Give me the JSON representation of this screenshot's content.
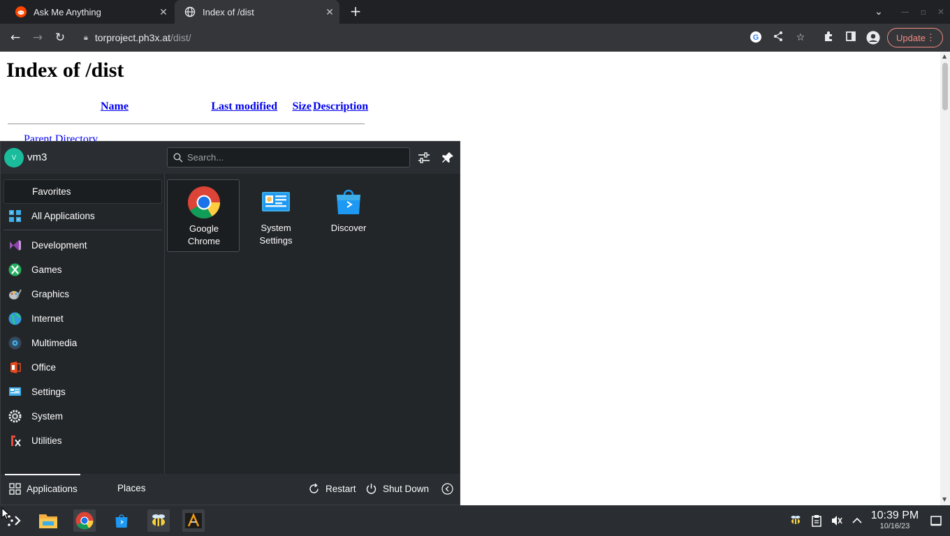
{
  "browser": {
    "tabs": [
      {
        "title": "Ask Me Anything",
        "active": false
      },
      {
        "title": "Index of /dist",
        "active": true
      }
    ],
    "url_host": "torproject.ph3x.at",
    "url_path": "/dist/",
    "update_label": "Update"
  },
  "page": {
    "heading": "Index of /dist",
    "columns": [
      "Name",
      "Last modified",
      "Size",
      "Description"
    ],
    "parent_link": "Parent Directory"
  },
  "launcher": {
    "user": "vm3",
    "avatar_letter": "V",
    "search_placeholder": "Search...",
    "categories": [
      {
        "label": "Favorites",
        "icon": "favorites-icon"
      },
      {
        "label": "All Applications",
        "icon": "all-applications-icon"
      },
      {
        "label": "Development",
        "icon": "development-icon"
      },
      {
        "label": "Games",
        "icon": "games-icon"
      },
      {
        "label": "Graphics",
        "icon": "graphics-icon"
      },
      {
        "label": "Internet",
        "icon": "internet-icon"
      },
      {
        "label": "Multimedia",
        "icon": "multimedia-icon"
      },
      {
        "label": "Office",
        "icon": "office-icon"
      },
      {
        "label": "Settings",
        "icon": "settings-icon"
      },
      {
        "label": "System",
        "icon": "system-icon"
      },
      {
        "label": "Utilities",
        "icon": "utilities-icon"
      }
    ],
    "apps": [
      {
        "line1": "Google",
        "line2": "Chrome"
      },
      {
        "line1": "System",
        "line2": "Settings"
      },
      {
        "line1": "Discover",
        "line2": ""
      }
    ],
    "footer": {
      "applications": "Applications",
      "places": "Places",
      "restart": "Restart",
      "shutdown": "Shut Down"
    }
  },
  "taskbar": {
    "time": "10:39 PM",
    "date": "10/16/23"
  }
}
